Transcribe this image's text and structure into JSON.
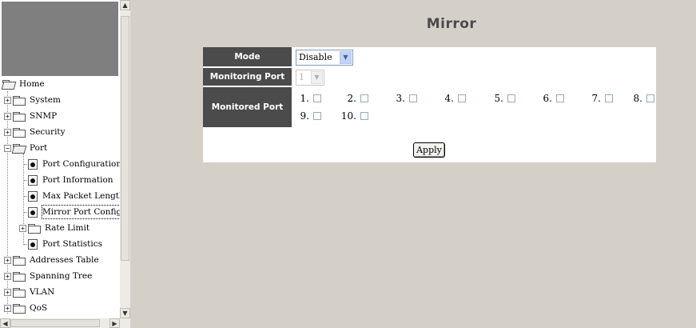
{
  "nav": {
    "tree": [
      {
        "label": "Home"
      },
      {
        "label": "System"
      },
      {
        "label": "SNMP"
      },
      {
        "label": "Security"
      },
      {
        "label": "Port"
      },
      {
        "label": "Port Configuration"
      },
      {
        "label": "Port Information"
      },
      {
        "label": "Max Packet Length"
      },
      {
        "label": "Mirror Port Configurat"
      },
      {
        "label": "Rate Limit"
      },
      {
        "label": "Port Statistics"
      },
      {
        "label": "Addresses Table"
      },
      {
        "label": "Spanning Tree"
      },
      {
        "label": "VLAN"
      },
      {
        "label": "QoS"
      }
    ]
  },
  "page": {
    "title": "Mirror"
  },
  "form": {
    "mode_label": "Mode",
    "mode_value": "Disable",
    "monitoring_label": "Monitoring Port",
    "monitoring_value": "1",
    "monitored_label": "Monitored Port",
    "ports": [
      "1.",
      "2.",
      "3.",
      "4.",
      "5.",
      "6.",
      "7.",
      "8.",
      "9.",
      "10."
    ],
    "apply_label": "Apply"
  },
  "colors": {
    "label_bg": "#4b4b4b",
    "page_bg": "#d4d0c8",
    "panel_bg": "#ffffff"
  }
}
